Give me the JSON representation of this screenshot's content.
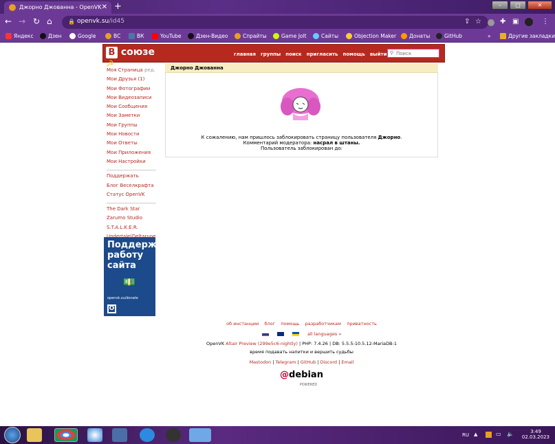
{
  "browser": {
    "tab_title": "Джорно Джованна - OpenVK",
    "url_host": "openvk.su",
    "url_path": "/id45",
    "bookmarks": [
      "Яндекс",
      "Дзен",
      "Google",
      "ВС",
      "ВК",
      "YouTube",
      "Дзен-Видео",
      "Спрайты",
      "Game Jolt",
      "Сайты",
      "Objection Maker",
      "Донаты",
      "GitHub"
    ],
    "other_bookmarks": "Другие закладки"
  },
  "site": {
    "logo": "В союзе",
    "logo_box": "В",
    "logo_text": "союзе",
    "nav": [
      "главная",
      "группы",
      "поиск",
      "пригласить",
      "помощь",
      "выйти"
    ],
    "search_placeholder": "Поиск",
    "sidebar": [
      [
        "Моя Страница",
        "Мои Друзья (1)",
        "Мои Фотографии",
        "Мои Видеозаписи",
        "Мои Сообщения",
        "Мои Заметки",
        "Мои Группы",
        "Мои Новости",
        "Мои Ответы",
        "Мои Приложения",
        "Мои Настройки"
      ],
      [
        "Поддержать",
        "Блог Веселкрафта",
        "Статус OpenVK"
      ],
      [
        "The Dark Star",
        "Zarumo Studio",
        "S.T.A.L.K.E.R.",
        "Undertale|Deltarune"
      ]
    ],
    "edit": "ред.",
    "donate": {
      "line1": "Поддержи",
      "line2": "работу",
      "line3": "сайта",
      "url": "openvk.su/donate"
    },
    "profile_name": "Джорно Джованна",
    "ban_text_pre": "К сожалению, нам пришлось заблокировать страницу пользователя ",
    "ban_user": "Джорно",
    "ban_comment_label": "Комментарий модератора: ",
    "ban_comment": "насрал в штаны.",
    "ban_until": "Пользователь заблокирован до:",
    "footer_links": [
      "об инстанции",
      "блог",
      "помощь",
      "разработчикам",
      "приватность"
    ],
    "all_languages": "all languages »",
    "version_pre": "OpenVK ",
    "version_link": "Altair Preview (299e5c6-nightly)",
    "version_post": " | PHP: 7.4.26 | DB: 5.5.5-10.5.12-MariaDB-1",
    "motto": "время подавать напитки и вершить судьбы",
    "social": [
      "Mastodon",
      "Telegram",
      "GitHub",
      "Discord",
      "Email"
    ],
    "debian": "debian",
    "debian_sub": "POWERED"
  },
  "taskbar": {
    "lang": "RU",
    "time": "3:49",
    "date": "02.03.2023"
  }
}
